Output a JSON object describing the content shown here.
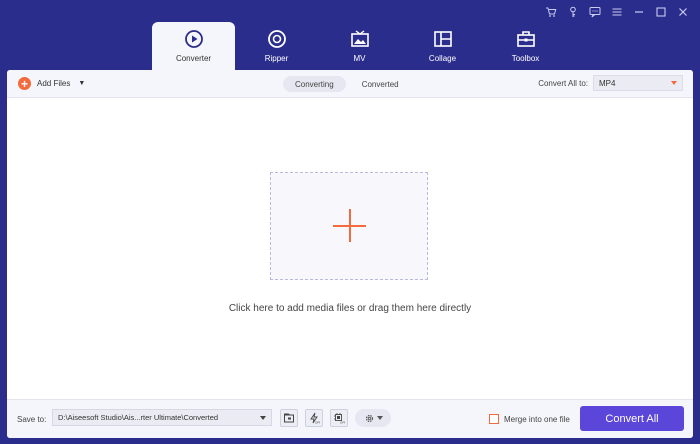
{
  "titlebar": {
    "controls": [
      "cart-icon",
      "key-icon",
      "feedback-icon",
      "menu-icon",
      "minimize-icon",
      "maximize-icon",
      "close-icon"
    ]
  },
  "tabs": [
    {
      "label": "Converter",
      "icon": "converter-icon",
      "active": true
    },
    {
      "label": "Ripper",
      "icon": "ripper-icon",
      "active": false
    },
    {
      "label": "MV",
      "icon": "mv-icon",
      "active": false
    },
    {
      "label": "Collage",
      "icon": "collage-icon",
      "active": false
    },
    {
      "label": "Toolbox",
      "icon": "toolbox-icon",
      "active": false
    }
  ],
  "toolbar": {
    "add_files_label": "Add Files",
    "sub_tabs": [
      {
        "label": "Converting",
        "active": true
      },
      {
        "label": "Converted",
        "active": false
      }
    ],
    "convert_all_to_label": "Convert All to:",
    "format_value": "MP4"
  },
  "main": {
    "drop_hint": "Click here to add media files or drag them here directly"
  },
  "bottom": {
    "save_to_label": "Save to:",
    "save_path": "D:\\Aiseesoft Studio\\Ais...rter Ultimate\\Converted",
    "merge_label": "Merge into one file",
    "merge_checked": false,
    "convert_all_label": "Convert All"
  },
  "colors": {
    "chrome": "#2b2d8c",
    "accent": "#f36b3d",
    "primary_button": "#5a46d8"
  }
}
